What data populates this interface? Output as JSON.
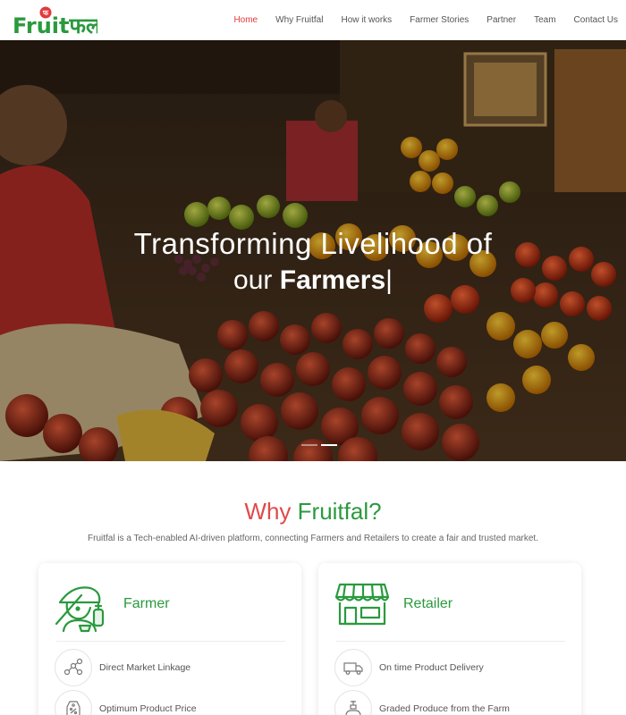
{
  "brand": {
    "logo_text": "Fruitफल",
    "logo_badge": "फ"
  },
  "nav": {
    "items": [
      {
        "label": "Home",
        "active": true
      },
      {
        "label": "Why Fruitfal",
        "active": false
      },
      {
        "label": "How it works",
        "active": false
      },
      {
        "label": "Farmer Stories",
        "active": false
      },
      {
        "label": "Partner",
        "active": false
      },
      {
        "label": "Team",
        "active": false
      },
      {
        "label": "Contact Us",
        "active": false
      }
    ]
  },
  "hero": {
    "line1": "Transforming Livelihood of",
    "line2_prefix": "our",
    "line2_bold": "Farmers",
    "cursor": "|",
    "slide_count": 2,
    "active_slide": 2
  },
  "why": {
    "title_prefix": "Why",
    "title_brand": "Fruitfal?",
    "subtitle": "Fruitfal is a Tech-enabled AI-driven platform, connecting Farmers and Retailers to create a fair and trusted market."
  },
  "cards": {
    "farmer": {
      "title": "Farmer",
      "icon": "farmer-icon",
      "features": [
        {
          "label": "Direct Market Linkage",
          "icon": "network-icon"
        },
        {
          "label": "Optimum Product Price",
          "icon": "price-tag-icon"
        }
      ]
    },
    "retailer": {
      "title": "Retailer",
      "icon": "storefront-icon",
      "features": [
        {
          "label": "On time Product Delivery",
          "icon": "delivery-truck-icon"
        },
        {
          "label": "Graded Produce from the Farm",
          "icon": "graded-produce-icon"
        }
      ]
    }
  },
  "colors": {
    "accent_red": "#e53b3b",
    "brand_green": "#2a9a3e",
    "text_gray": "#555555"
  }
}
